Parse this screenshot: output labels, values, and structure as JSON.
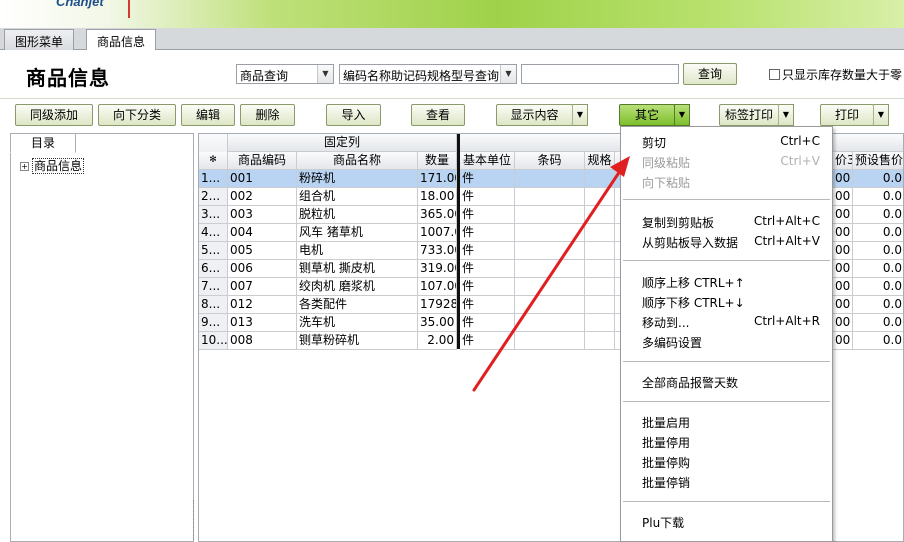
{
  "app": {
    "logo_text": "Chanjet",
    "banner_text": ""
  },
  "tabs": [
    {
      "label": "图形菜单"
    },
    {
      "label": "商品信息"
    }
  ],
  "header": {
    "title": "商品信息",
    "query_type": "商品查询",
    "query_field": "编码名称助记码规格型号查询",
    "search_value": "",
    "search_button": "查询",
    "stock_filter_label": "只显示库存数量大于零"
  },
  "toolbar": {
    "same_level_add": "同级添加",
    "down_category": "向下分类",
    "edit": "编辑",
    "delete": "删除",
    "import": "导入",
    "view": "查看",
    "show_content": "显示内容",
    "other": "其它",
    "label_print": "标签打印",
    "print": "打印"
  },
  "sidebar": {
    "tab": "目录",
    "root": "商品信息",
    "expand_symbol": "+"
  },
  "grid": {
    "fixed_group": "固定列",
    "corner": "✻",
    "columns": {
      "code": "商品编码",
      "name": "商品名称",
      "qty": "数量",
      "unit": "基本单位",
      "barcode": "条码",
      "spec": "规格",
      "price3": "价3",
      "preset_price": "预设售价"
    },
    "rows": [
      {
        "idx": "1...",
        "code": "001",
        "name": "粉碎机",
        "qty": "171.00",
        "unit": "件",
        "p3": "00",
        "pre": "0.0"
      },
      {
        "idx": "2...",
        "code": "002",
        "name": "组合机",
        "qty": "18.00",
        "unit": "件",
        "p3": "00",
        "pre": "0.0"
      },
      {
        "idx": "3...",
        "code": "003",
        "name": "脱粒机",
        "qty": "365.00",
        "unit": "件",
        "p3": "00",
        "pre": "0.0"
      },
      {
        "idx": "4...",
        "code": "004",
        "name": "风车 猪草机",
        "qty": "1007.0",
        "unit": "件",
        "p3": "00",
        "pre": "0.0"
      },
      {
        "idx": "5...",
        "code": "005",
        "name": "电机",
        "qty": "733.00",
        "unit": "件",
        "p3": "00",
        "pre": "0.0"
      },
      {
        "idx": "6...",
        "code": "006",
        "name": "铡草机 撕皮机",
        "qty": "319.00",
        "unit": "件",
        "p3": "00",
        "pre": "0.0"
      },
      {
        "idx": "7...",
        "code": "007",
        "name": "绞肉机 磨浆机",
        "qty": "107.00",
        "unit": "件",
        "p3": "00",
        "pre": "0.0"
      },
      {
        "idx": "8...",
        "code": "012",
        "name": "各类配件",
        "qty": "17928.",
        "unit": "件",
        "p3": "00",
        "pre": "0.0"
      },
      {
        "idx": "9...",
        "code": "013",
        "name": "洗车机",
        "qty": "35.00",
        "unit": "件",
        "p3": "00",
        "pre": "0.0"
      },
      {
        "idx": "10...",
        "code": "008",
        "name": "铡草粉碎机",
        "qty": "2.00",
        "unit": "件",
        "p3": "00",
        "pre": "0.0"
      }
    ]
  },
  "context_menu": {
    "items": [
      {
        "label": "剪切",
        "shortcut": "Ctrl+C",
        "disabled": false
      },
      {
        "label": "同级粘贴",
        "shortcut": "Ctrl+V",
        "disabled": true
      },
      {
        "label": "向下粘贴",
        "shortcut": "",
        "disabled": true
      },
      {
        "label": "复制到剪贴板",
        "shortcut": "Ctrl+Alt+C",
        "disabled": false
      },
      {
        "label": "从剪贴板导入数据",
        "shortcut": "Ctrl+Alt+V",
        "disabled": false
      },
      {
        "label": "顺序上移 CTRL+↑",
        "shortcut": "",
        "disabled": false
      },
      {
        "label": "顺序下移 CTRL+↓",
        "shortcut": "",
        "disabled": false
      },
      {
        "label": "移动到...",
        "shortcut": "Ctrl+Alt+R",
        "disabled": false
      },
      {
        "label": "多编码设置",
        "shortcut": "",
        "disabled": false
      },
      {
        "label": "全部商品报警天数",
        "shortcut": "",
        "disabled": false
      },
      {
        "label": "批量启用",
        "shortcut": "",
        "disabled": false
      },
      {
        "label": "批量停用",
        "shortcut": "",
        "disabled": false
      },
      {
        "label": "批量停购",
        "shortcut": "",
        "disabled": false
      },
      {
        "label": "批量停销",
        "shortcut": "",
        "disabled": false
      },
      {
        "label": "Plu下载",
        "shortcut": "",
        "disabled": false
      }
    ]
  },
  "colors": {
    "selected_row": "#b9d4f2",
    "active_button": "#7cbf2c",
    "annotation_arrow": "#e02020"
  }
}
